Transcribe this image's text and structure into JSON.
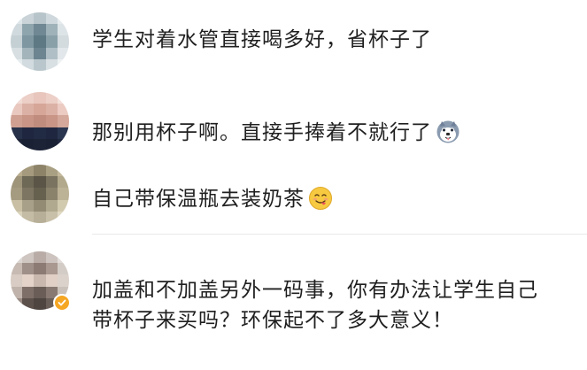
{
  "comments": [
    {
      "text": "学生对着水管直接喝多好，省杯子了",
      "emoji": null
    },
    {
      "text": "那别用杯子啊。直接手捧着不就行了",
      "emoji": "husky-dog-face-icon"
    },
    {
      "text": "自己带保温瓶去装奶茶",
      "emoji": "smiling-face-tongue-icon"
    },
    {
      "text_line1": "加盖和不加盖另外一码事，你有办法让学生自己",
      "text_line2": "带杯子来买吗？环保起不了多大意义！",
      "emoji": null,
      "verified": true
    }
  ],
  "colors": {
    "divider": "#e9e9e9",
    "text": "#1f1f1f",
    "verified_badge": "#f5a623"
  }
}
